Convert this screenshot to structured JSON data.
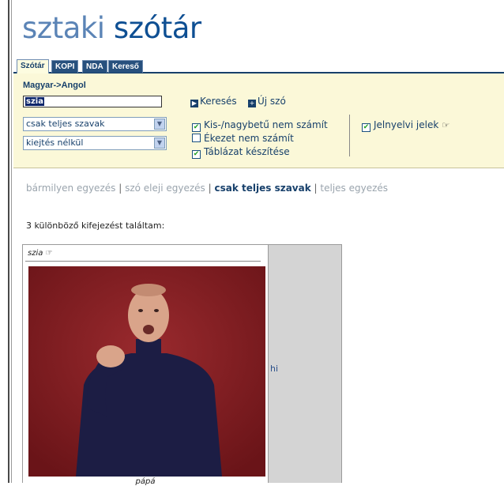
{
  "logo": {
    "part1": "sztaki ",
    "part2": "szótár"
  },
  "tabs": [
    {
      "label": "Szótár",
      "active": true
    },
    {
      "label": "KOPI",
      "active": false
    },
    {
      "label": "NDA",
      "active": false
    },
    {
      "label": "Kereső",
      "active": false
    }
  ],
  "search": {
    "direction": "Magyar->Angol",
    "value": "szia",
    "match_select": "csak teljes szavak",
    "pronunciation_select": "kiejtés nélkül",
    "search_label": "Keresés",
    "new_word_label": "Új szó"
  },
  "options": {
    "case_insensitive": {
      "label": "Kis-/nagybetű nem számít",
      "checked": true
    },
    "accent_insensitive": {
      "label": "Ékezet nem számít",
      "checked": false
    },
    "make_table": {
      "label": "Táblázat készítése",
      "checked": true
    },
    "sign_language": {
      "label": "Jelnyelvi jelek",
      "checked": true
    }
  },
  "filters": {
    "any": "bármilyen egyezés",
    "word_start": "szó eleji egyezés",
    "whole_words": "csak teljes szavak",
    "exact": "teljes egyezés",
    "separator": "|"
  },
  "results": {
    "summary": "3 különböző kifejezést találtam:",
    "rows": [
      {
        "word": "szia",
        "caption": "pápá",
        "translation": "hi"
      }
    ]
  },
  "icons": {
    "hand": "hand-sign-icon",
    "play": "play-icon",
    "plus": "plus-icon",
    "dropdown": "chevron-down-icon"
  },
  "colors": {
    "brand_light": "#5b84b6",
    "brand_dark": "#0e4f93",
    "tab_bg": "#27507d",
    "panel_bg": "#fbf8d8",
    "video_bg": "#7a1a1e"
  }
}
